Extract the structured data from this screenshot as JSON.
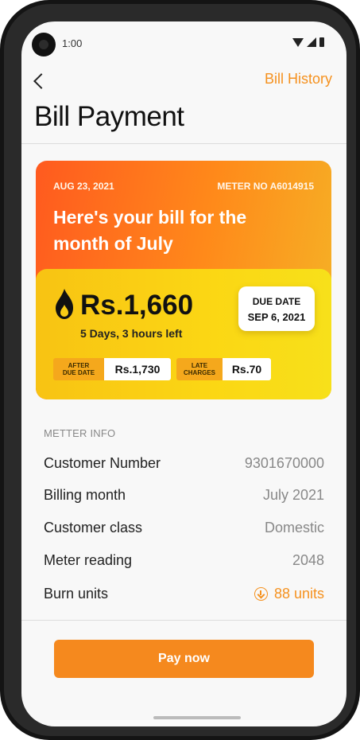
{
  "status_bar": {
    "time": "1:00"
  },
  "header": {
    "bill_history": "Bill History",
    "title": "Bill Payment"
  },
  "bill_card": {
    "date": "AUG 23, 2021",
    "meter_no": "METER NO A6014915",
    "headline": "Here's your bill for the month of July",
    "amount": "Rs.1,660",
    "time_left": "5 Days, 3 hours left",
    "due_label": "DUE DATE",
    "due_date": "SEP 6, 2021",
    "after_due_label_1": "AFTER",
    "after_due_label_2": "DUE DATE",
    "after_due_value": "Rs.1,730",
    "late_label_1": "LATE",
    "late_label_2": "CHARGES",
    "late_value": "Rs.70"
  },
  "meter_info": {
    "label": "METTER INFO",
    "rows": [
      {
        "label": "Customer Number",
        "value": "9301670000"
      },
      {
        "label": "Billing month",
        "value": "July 2021"
      },
      {
        "label": "Customer class",
        "value": "Domestic"
      },
      {
        "label": "Meter reading",
        "value": "2048"
      },
      {
        "label": "Burn units",
        "value": "88 units"
      }
    ]
  },
  "pay_button": "Pay now",
  "colors": {
    "accent": "#f5911e",
    "card_top": "#ff5a1f",
    "card_bottom": "#fbd714"
  }
}
